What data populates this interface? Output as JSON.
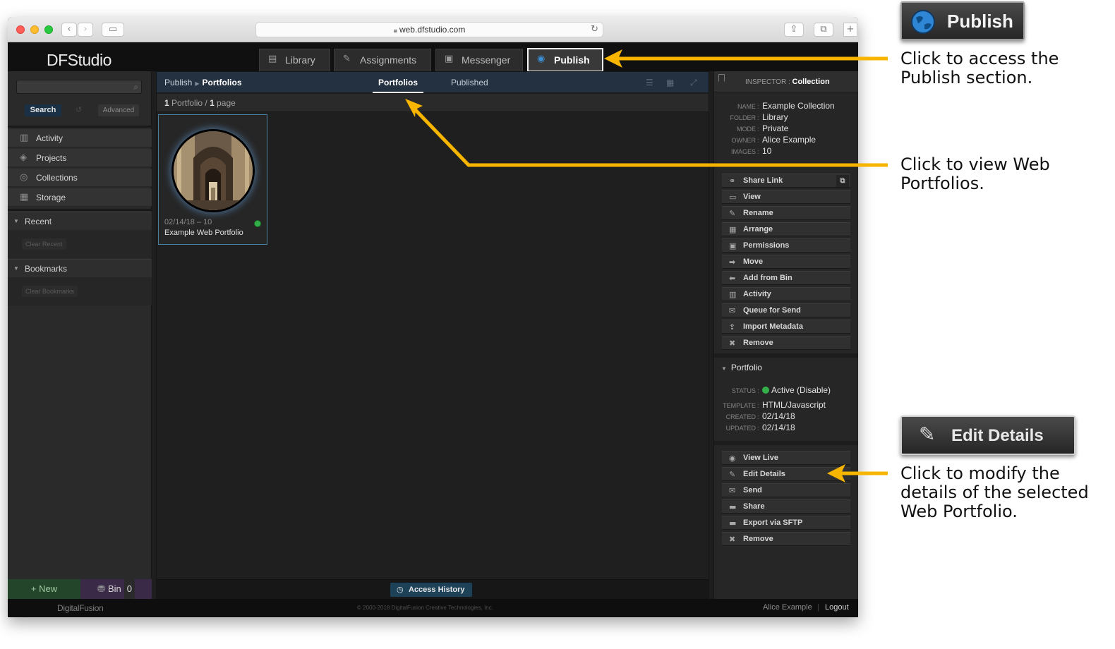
{
  "browser": {
    "url": "web.dfstudio.com",
    "traffic_colors": [
      "#ff5f57",
      "#febc2e",
      "#28c840"
    ]
  },
  "app": {
    "logo": "DFStudio",
    "tabs": [
      {
        "label": "Library",
        "icon": "library-icon"
      },
      {
        "label": "Assignments",
        "icon": "assignments-icon"
      },
      {
        "label": "Messenger",
        "icon": "messenger-icon"
      },
      {
        "label": "Publish",
        "icon": "globe-icon",
        "active": true
      }
    ]
  },
  "sidebar": {
    "search_button": "Search",
    "advanced_button": "Advanced",
    "nav": [
      {
        "label": "Activity",
        "icon": "activity-icon"
      },
      {
        "label": "Projects",
        "icon": "projects-icon"
      },
      {
        "label": "Collections",
        "icon": "collections-icon"
      },
      {
        "label": "Storage",
        "icon": "storage-icon"
      }
    ],
    "recent": {
      "title": "Recent",
      "clear_label": "Clear Recent"
    },
    "bookmarks": {
      "title": "Bookmarks",
      "clear_label": "Clear Bookmarks"
    },
    "new_button": "New",
    "bin_button": "Bin",
    "bin_count": "0"
  },
  "main": {
    "breadcrumb": {
      "root": "Publish",
      "current": "Portfolios"
    },
    "subtabs": [
      {
        "label": "Portfolios",
        "active": true
      },
      {
        "label": "Published",
        "active": false
      }
    ],
    "count": {
      "portfolios": "1",
      "portfolio_word": "Portfolio",
      "pages": "1",
      "page_word": "page"
    },
    "portfolio_card": {
      "date_line": "02/14/18 – 10",
      "name": "Example Web Portfolio",
      "status_color": "#34b04a"
    },
    "access_history_button": "Access History"
  },
  "inspector": {
    "header_label": "INSPECTOR :",
    "header_value": "Collection",
    "meta": [
      {
        "key": "NAME :",
        "value": "Example Collection"
      },
      {
        "key": "FOLDER :",
        "value": "Library"
      },
      {
        "key": "MODE :",
        "value": "Private"
      },
      {
        "key": "OWNER :",
        "value": "Alice Example"
      },
      {
        "key": "IMAGES :",
        "value": "10"
      }
    ],
    "actions": [
      {
        "label": "Share Link",
        "icon": "link-icon"
      },
      {
        "label": "View",
        "icon": "view-icon"
      },
      {
        "label": "Rename",
        "icon": "pencil-icon"
      },
      {
        "label": "Arrange",
        "icon": "grid-icon"
      },
      {
        "label": "Permissions",
        "icon": "lock-icon"
      },
      {
        "label": "Move",
        "icon": "arrow-right-icon"
      },
      {
        "label": "Add from Bin",
        "icon": "arrow-left-icon"
      },
      {
        "label": "Activity",
        "icon": "activity-icon"
      },
      {
        "label": "Queue for Send",
        "icon": "queue-icon"
      },
      {
        "label": "Import Metadata",
        "icon": "import-icon"
      },
      {
        "label": "Remove",
        "icon": "remove-icon"
      }
    ],
    "portfolio_section": {
      "title": "Portfolio",
      "status_key": "STATUS :",
      "status_value": "Active",
      "status_action": "(Disable)",
      "template_key": "TEMPLATE :",
      "template_value": "HTML/Javascript",
      "created_key": "CREATED :",
      "created_value": "02/14/18",
      "updated_key": "UPDATED :",
      "updated_value": "02/14/18"
    },
    "portfolio_actions": [
      {
        "label": "View Live",
        "icon": "globe-icon"
      },
      {
        "label": "Edit Details",
        "icon": "pencil-icon"
      },
      {
        "label": "Send",
        "icon": "envelope-icon"
      },
      {
        "label": "Share",
        "icon": "folder-icon"
      },
      {
        "label": "Export via SFTP",
        "icon": "folder-icon"
      },
      {
        "label": "Remove",
        "icon": "remove-icon"
      }
    ]
  },
  "footer": {
    "brand": "DigitalFusion",
    "copyright": "© 2000-2018 DigitalFusion Creative Technologies, Inc.",
    "user": "Alice Example",
    "logout": "Logout"
  },
  "callouts": {
    "publish_button": "Publish",
    "publish_text_1": "Click to access the",
    "publish_text_2": "Publish section.",
    "portfolios_text_1": "Click to view Web",
    "portfolios_text_2": "Portfolios.",
    "edit_button": "Edit Details",
    "edit_text_1": "Click to modify the",
    "edit_text_2": "details of the selected",
    "edit_text_3": "Web Portfolio.",
    "arrow_color": "#f7b500"
  }
}
